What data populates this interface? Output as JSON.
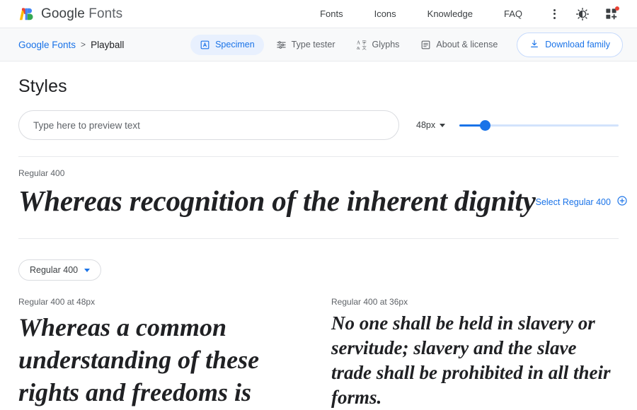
{
  "header": {
    "brand_google": "Google",
    "brand_fonts": "Fonts",
    "logo_icon": "google-fonts-logo",
    "nav": [
      {
        "label": "Fonts"
      },
      {
        "label": "Icons"
      },
      {
        "label": "Knowledge"
      },
      {
        "label": "FAQ"
      }
    ],
    "kebab_icon": "more-vertical-icon",
    "theme_icon": "dark-mode-icon",
    "apps_icon": "add-to-collection-icon",
    "apps_badge": true
  },
  "subheader": {
    "breadcrumb_root": "Google Fonts",
    "breadcrumb_separator": ">",
    "breadcrumb_current": "Playball",
    "tabs": [
      {
        "label": "Specimen",
        "icon": "specimen-icon",
        "active": true
      },
      {
        "label": "Type tester",
        "icon": "type-tester-icon",
        "active": false
      },
      {
        "label": "Glyphs",
        "icon": "glyphs-icon",
        "active": false
      },
      {
        "label": "About & license",
        "icon": "about-license-icon",
        "active": false
      }
    ],
    "download_label": "Download family",
    "download_icon": "download-icon"
  },
  "main": {
    "page_title": "Styles",
    "preview_placeholder": "Type here to preview text",
    "preview_value": "",
    "size_value": "48px",
    "size_caret_icon": "chevron-down-icon",
    "slider_percent": 16,
    "style_label": "Regular 400",
    "specimen_text": "Whereas recognition of the inherent dignity",
    "select_style_label": "Select Regular 400",
    "select_style_icon": "plus-circle-icon",
    "style_chip_label": "Regular 400",
    "style_chip_caret_icon": "chevron-down-icon",
    "columns": [
      {
        "label": "Regular 400 at 48px",
        "text": "Whereas a common understanding of these rights and freedoms is"
      },
      {
        "label": "Regular 400 at 36px",
        "text": "No one shall be held in slavery or servitude; slavery and the slave trade shall be prohibited in all their forms."
      }
    ]
  },
  "colors": {
    "accent": "#1a73e8",
    "accent_soft": "#e8f0fe",
    "text": "#202124",
    "muted": "#5f6368",
    "divider": "#e8eaed",
    "badge": "#ea4335"
  }
}
